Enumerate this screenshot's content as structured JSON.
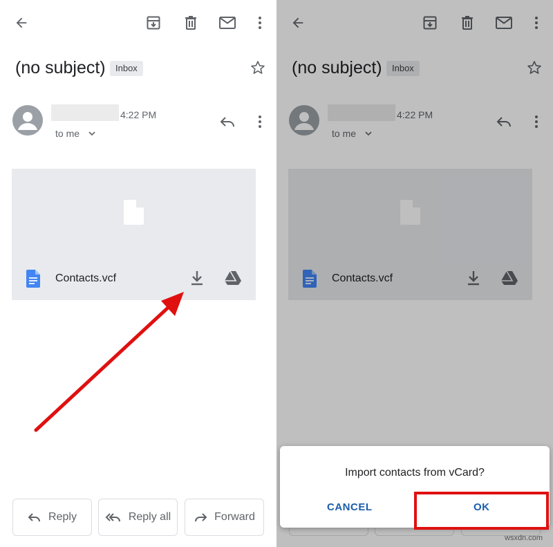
{
  "email": {
    "subject": "(no subject)",
    "label_badge": "Inbox",
    "time": "4:22 PM",
    "recipient": "to me",
    "attachment_name": "Contacts.vcf"
  },
  "actions": {
    "reply": "Reply",
    "reply_all": "Reply all",
    "forward": "Forward"
  },
  "dialog": {
    "message": "Import contacts from vCard?",
    "cancel": "CANCEL",
    "ok": "OK"
  },
  "icons": {
    "toolbar": [
      "back-arrow-icon",
      "archive-icon",
      "delete-icon",
      "mail-icon",
      "more-vert-icon"
    ],
    "attachment": [
      "file-icon",
      "doc-icon",
      "download-icon",
      "drive-icon"
    ]
  },
  "colors": {
    "accent_blue": "#1a73e8",
    "dialog_button": "#1a5dab",
    "highlight_red": "#e01010",
    "attachment_bg": "#e8eaed"
  },
  "watermark": "wsxdn.com"
}
